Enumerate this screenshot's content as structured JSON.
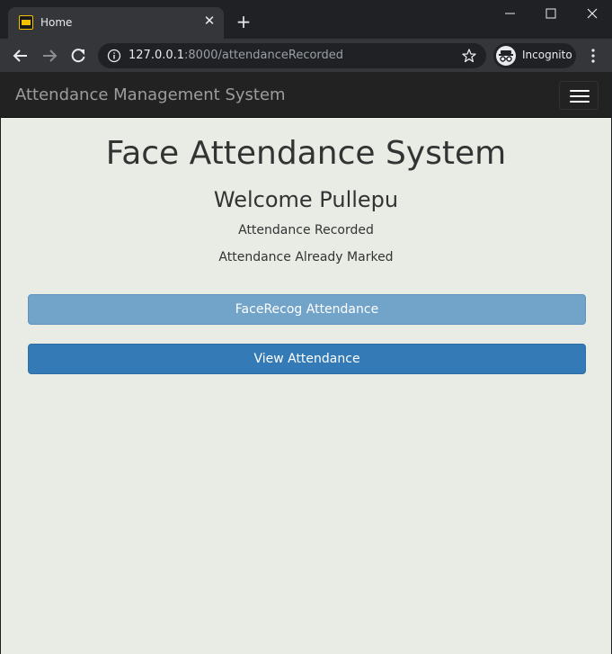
{
  "browser": {
    "tab_title": "Home",
    "url_host": "127.0.0.1",
    "url_rest": ":8000/attendanceRecorded",
    "profile_label": "Incognito"
  },
  "navbar": {
    "brand": "Attendance Management System"
  },
  "main": {
    "title": "Face Attendance System",
    "welcome": "Welcome Pullepu",
    "message1": "Attendance Recorded",
    "message2": "Attendance Already Marked",
    "facerecog_button": "FaceRecog Attendance",
    "view_button": "View Attendance"
  },
  "colors": {
    "primary": "#337ab7",
    "primary_disabled": "#72a3c9",
    "navbar_bg": "#222222",
    "page_bg": "#e8ece5"
  }
}
